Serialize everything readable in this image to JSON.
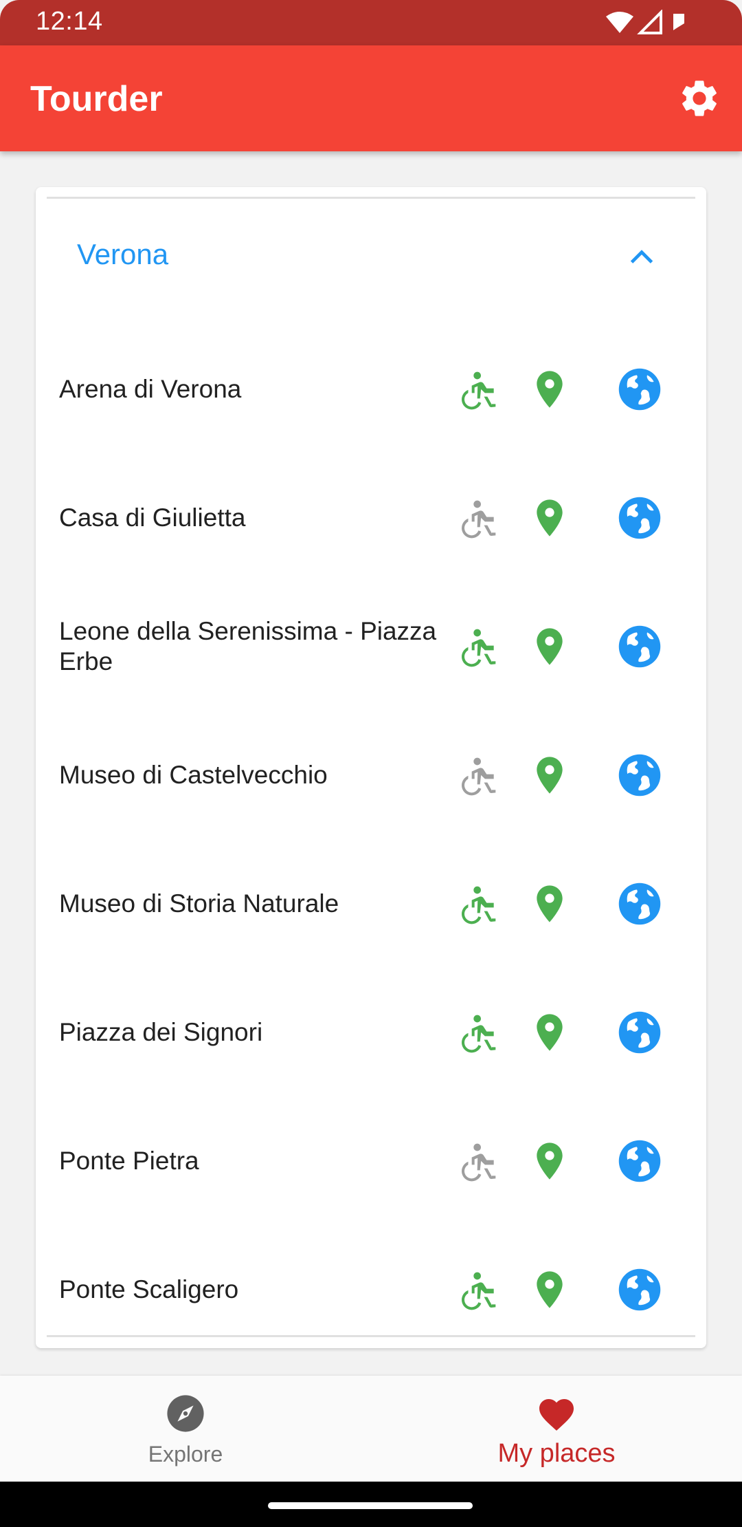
{
  "status_bar": {
    "time": "12:14",
    "icons": [
      "wifi-icon",
      "cell-signal-icon",
      "battery-icon"
    ]
  },
  "app_bar": {
    "title": "Tourder",
    "settings_icon": "gear-icon",
    "background": "#f44336"
  },
  "group": {
    "title": "Verona",
    "expanded": true,
    "accent": "#2196f3"
  },
  "places": [
    {
      "name": "Arena di Verona",
      "accessible": true
    },
    {
      "name": "Casa di Giulietta",
      "accessible": false
    },
    {
      "name": "Leone della Serenissima - Piazza Erbe",
      "accessible": true
    },
    {
      "name": "Museo di Castelvecchio",
      "accessible": false
    },
    {
      "name": "Museo di Storia Naturale",
      "accessible": true
    },
    {
      "name": "Piazza dei Signori",
      "accessible": true
    },
    {
      "name": "Ponte Pietra",
      "accessible": false
    },
    {
      "name": "Ponte Scaligero",
      "accessible": true
    }
  ],
  "colors": {
    "accessible": "#4caf50",
    "not_accessible": "#9e9e9e",
    "pin": "#4caf50",
    "globe": "#2196f3",
    "active_nav": "#c62828"
  },
  "bottom_nav": {
    "items": [
      {
        "label": "Explore",
        "icon": "compass-icon",
        "active": false
      },
      {
        "label": "My places",
        "icon": "heart-icon",
        "active": true
      }
    ]
  }
}
